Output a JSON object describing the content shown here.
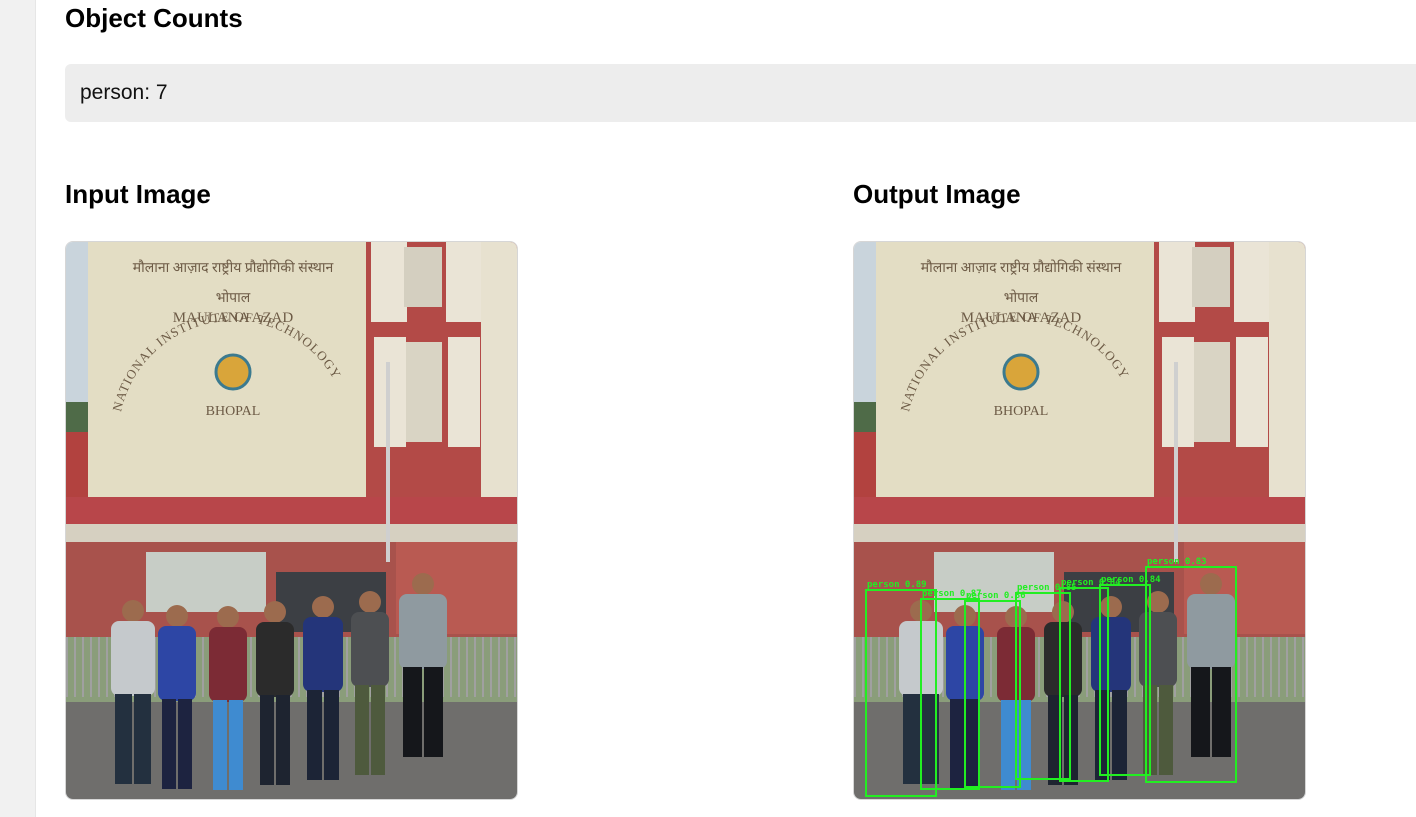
{
  "counts": {
    "title": "Object Counts",
    "text": "person: 7"
  },
  "input": {
    "title": "Input Image"
  },
  "output": {
    "title": "Output Image"
  },
  "photo_text": {
    "hindi_line": "मौलाना आज़ाद राष्ट्रीय प्रौद्योगिकी संस्थान",
    "bhopal_hindi": "भोपाल",
    "maulana_azad": "MAULANA AZAD",
    "nit_arc": "NATIONAL INSTITUTE OF TECHNOLOGY",
    "bhopal": "BHOPAL"
  },
  "detections": [
    {
      "label": "person 0.89"
    },
    {
      "label": "person 0.87"
    },
    {
      "label": "person 0.86"
    },
    {
      "label": "person 0.85"
    },
    {
      "label": "person 0.84"
    },
    {
      "label": "person 0.84"
    },
    {
      "label": "person 0.83"
    }
  ],
  "colors": {
    "detection_box": "#22ee22",
    "counts_background": "#ededed"
  }
}
